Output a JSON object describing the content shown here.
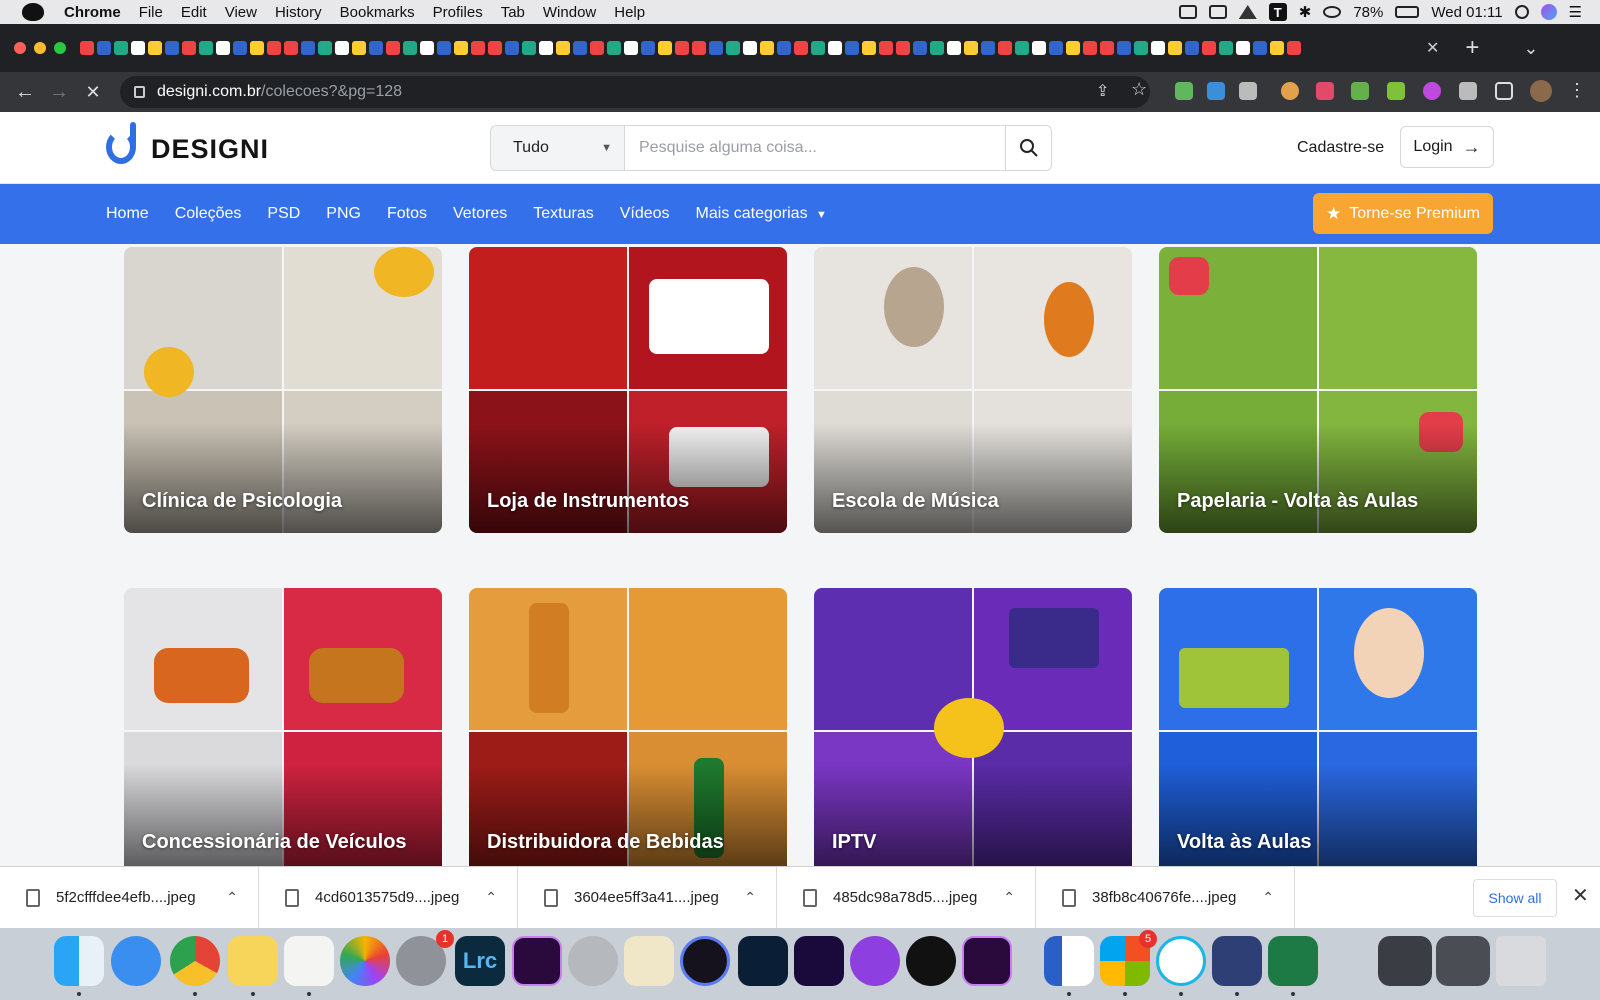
{
  "menubar": {
    "app": "Chrome",
    "items": [
      "File",
      "Edit",
      "View",
      "History",
      "Bookmarks",
      "Profiles",
      "Tab",
      "Window",
      "Help"
    ],
    "battery": "78%",
    "clock": "Wed 01:11"
  },
  "browser": {
    "host": "designi.com.br",
    "path": "/colecoes?&pg=128",
    "new_tab_symbol": "+",
    "tab_menu_symbol": "⌄"
  },
  "site": {
    "logo_text": "DESIGNI",
    "search_category": "Tudo",
    "search_placeholder": "Pesquise alguma coisa...",
    "signup_label": "Cadastre-se",
    "login_label": "Login",
    "nav": [
      "Home",
      "Coleções",
      "PSD",
      "PNG",
      "Fotos",
      "Vetores",
      "Texturas",
      "Vídeos",
      "Mais categorias"
    ],
    "premium_label": "Torne-se Premium",
    "accent_color": "#3470ea",
    "premium_color": "#f9a532"
  },
  "collections": [
    {
      "title": "Clínica de Psicologia",
      "colors": [
        "#d9d6cf",
        "#e2ddd3",
        "#c9c2b5",
        "#d3cdc2"
      ]
    },
    {
      "title": "Loja de Instrumentos",
      "colors": [
        "#c21e1e",
        "#b3151e",
        "#8c1219",
        "#c0202a"
      ]
    },
    {
      "title": "Escola de Música",
      "colors": [
        "#e7e4df",
        "#e8e5e0",
        "#dfdcd6",
        "#e4e1dc"
      ]
    },
    {
      "title": "Papelaria - Volta às Aulas",
      "colors": [
        "#7bb13a",
        "#86b840",
        "#75ad38",
        "#82b63f"
      ]
    },
    {
      "title": "Concessionária de Veículos",
      "colors": [
        "#e4e4e6",
        "#d92a45",
        "#dadadd",
        "#cf2240"
      ]
    },
    {
      "title": "Distribuidora de Bebidas",
      "colors": [
        "#e59c3c",
        "#e59a36",
        "#9e1c18",
        "#d98e33"
      ]
    },
    {
      "title": "IPTV",
      "colors": [
        "#5d2fb0",
        "#6a2bb8",
        "#7a37c4",
        "#5a2ca8"
      ]
    },
    {
      "title": "Volta às Aulas",
      "colors": [
        "#2d6fe8",
        "#2f78ea",
        "#1f5fd9",
        "#2a68e2"
      ]
    }
  ],
  "downloads": {
    "files": [
      "5f2cfffdee4efb....jpeg",
      "4cd6013575d9....jpeg",
      "3604ee5ff3a41....jpeg",
      "485dc98a78d5....jpeg",
      "38fb8c40676fe....jpeg"
    ],
    "show_all_label": "Show all"
  },
  "dock": {
    "settings_badge": "1",
    "office_badge": "5"
  }
}
